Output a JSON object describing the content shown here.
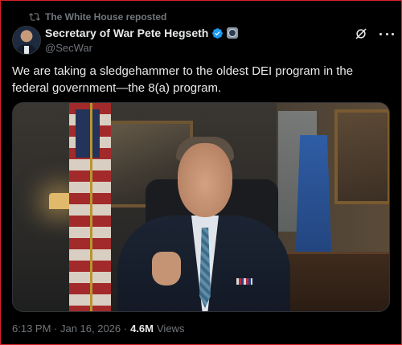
{
  "repost": {
    "label": "The White House reposted"
  },
  "author": {
    "name": "Secretary of War Pete Hegseth",
    "handle": "@SecWar",
    "verified_color": "#1d9bf0"
  },
  "tweet": {
    "text": "We are taking a sledgehammer to the oldest DEI program in the federal government—the 8(a) program."
  },
  "meta": {
    "time": "6:13 PM · Jan 16, 2026 ·",
    "views_count": "4.6M",
    "views_label": "Views"
  },
  "colors": {
    "background": "#000000",
    "text": "#e7e9ea",
    "muted": "#71767b",
    "accent": "#1d9bf0"
  }
}
